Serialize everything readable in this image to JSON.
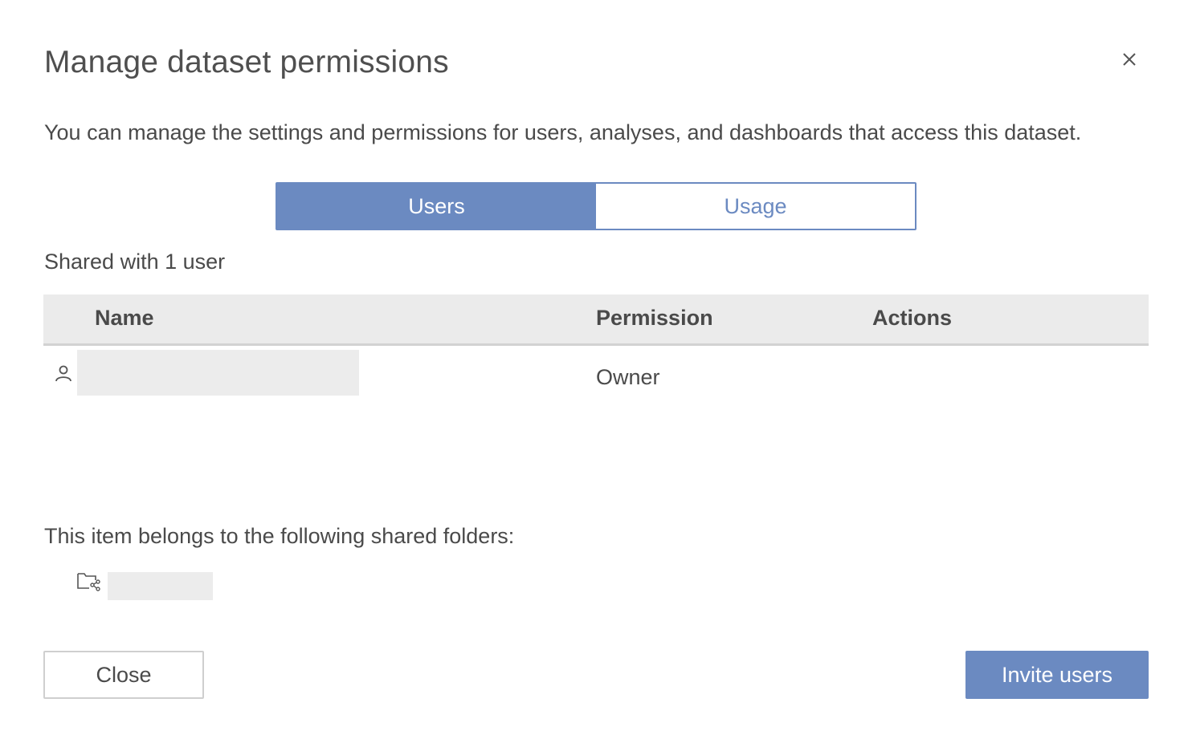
{
  "dialog": {
    "title": "Manage dataset permissions",
    "close_icon": "close-icon",
    "description": "You can manage the settings and permissions for users, analyses, and dashboards that access this dataset."
  },
  "tabs": [
    {
      "label": "Users",
      "active": true
    },
    {
      "label": "Usage",
      "active": false
    }
  ],
  "shared_count_text": "Shared with 1 user",
  "table": {
    "columns": [
      "Name",
      "Permission",
      "Actions"
    ],
    "rows": [
      {
        "icon": "user-icon",
        "name": "",
        "permission": "Owner",
        "actions": ""
      }
    ]
  },
  "folders": {
    "label": "This item belongs to the following shared folders:",
    "items": [
      {
        "icon": "shared-folder-icon",
        "name": ""
      }
    ]
  },
  "footer": {
    "close_label": "Close",
    "invite_label": "Invite users"
  },
  "colors": {
    "accent": "#6b8ac1",
    "header_bg": "#ebebeb",
    "redacted": "#ececec"
  }
}
